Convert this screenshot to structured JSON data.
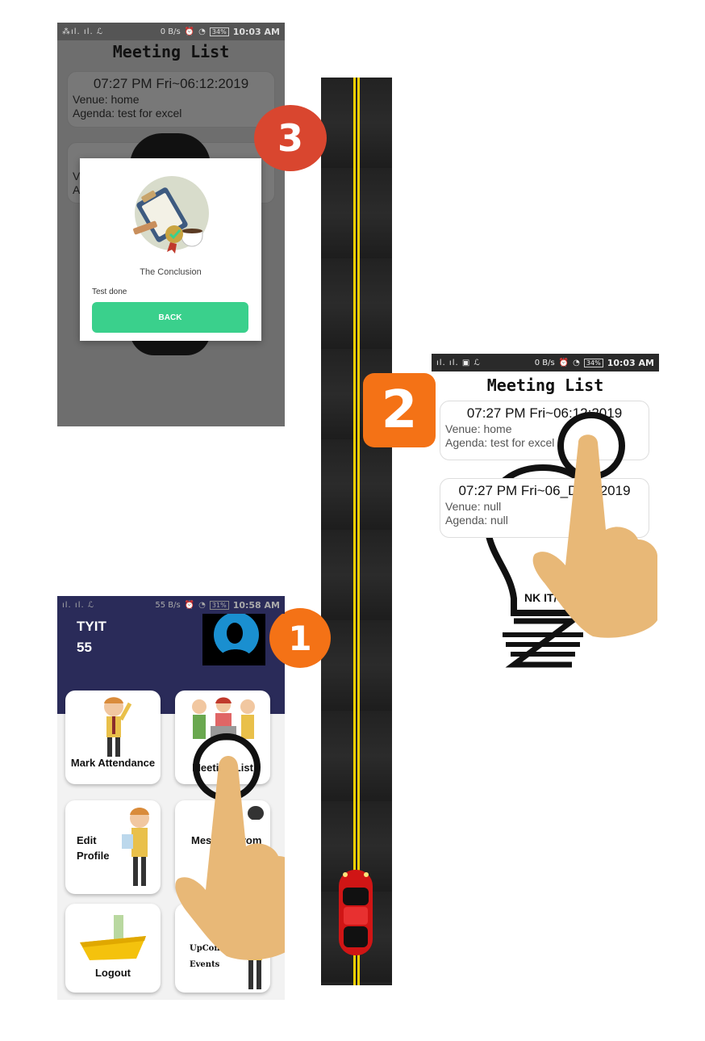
{
  "status_bar_screen3": {
    "signal": "⁂ıl. ıl. ℒ",
    "net": "0 B/s",
    "battery": "34%",
    "time": "10:03 AM"
  },
  "status_bar_screen2": {
    "signal": "ıl. ıl. ▣ ℒ",
    "net": "0 B/s",
    "battery": "34%",
    "time": "10:03 AM"
  },
  "status_bar_screen1": {
    "signal": "ıl. ıl. ℒ",
    "net": "55 B/s",
    "battery": "31%",
    "time": "10:58 AM"
  },
  "steps": {
    "one": "1",
    "two": "2",
    "three": "3"
  },
  "screen3": {
    "title": "Meeting List",
    "card1": {
      "datetime": "07:27 PM Fri~06:12:2019",
      "venue": "Venue: home",
      "agenda": "Agenda: test for excel"
    },
    "card2": {
      "venue_partial": "V",
      "agenda_partial": "A"
    },
    "dialog": {
      "heading": "The Conclusion",
      "text": "Test done",
      "button": "BACK"
    }
  },
  "screen2": {
    "title": "Meeting List",
    "meetings": [
      {
        "datetime": "07:27 PM Fri~06:12:2019",
        "venue": "Venue: home",
        "agenda": "Agenda: test for excel"
      },
      {
        "datetime": "07:27 PM Fri~06_Dec_2019",
        "venue": "Venue: null",
        "agenda": "Agenda: null"
      }
    ],
    "logo_text": "NK IT/CS"
  },
  "screen1": {
    "user_name": "TYIT",
    "user_count": "55",
    "tiles": {
      "mark_attendance": "Mark Attendance",
      "meeting_list": "Meeting List",
      "edit_profile": "Edit Profile",
      "message": "Message from",
      "logout": "Logout",
      "upcoming_events": "UpComing Events"
    }
  },
  "colors": {
    "header": "#2a2b59",
    "accent_green": "#3ad08c",
    "badge_orange": "#f47216",
    "badge_red": "#d9462f",
    "road_line": "#f5d000"
  }
}
